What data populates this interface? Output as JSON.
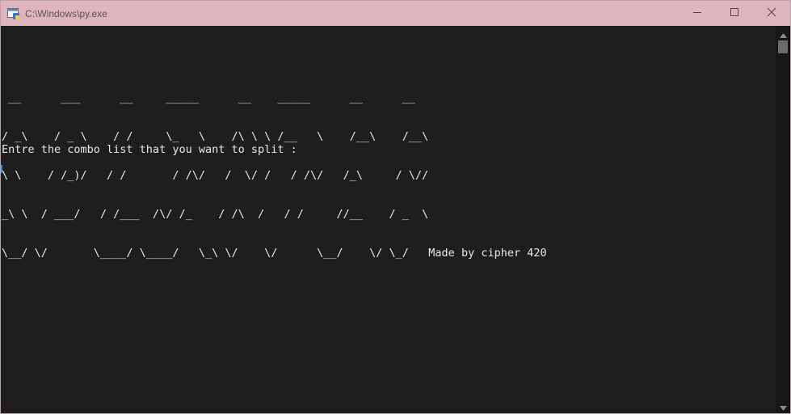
{
  "window": {
    "title": "C:\\Windows\\py.exe"
  },
  "controls": {
    "minimize": "minimize",
    "maximize": "maximize",
    "close": "close"
  },
  "console": {
    "banner_lines": [
      " __      ___      __     _____      __    _____      __      __",
      "/ _\\    / _ \\    / /     \\_   \\    /\\ \\ \\ /__   \\    /__\\    /__\\",
      "\\ \\    / /_)/   / /       / /\\/   /  \\/ /   / /\\/   /_\\     / \\//",
      "_\\ \\  / ___/   / /___  /\\/ /_    / /\\  /   / /     //__    / _  \\",
      "\\__/ \\/       \\____/ \\____/   \\_\\ \\/    \\/      \\__/    \\/ \\_/   Made by cipher 420"
    ],
    "prompt": "Entre the combo list that you want to split :"
  },
  "colors": {
    "titlebar": "#e0b4bd",
    "console_bg": "#1e1e1e",
    "console_text": "#e8e8e8"
  },
  "icons": {
    "app": "python-console-icon",
    "minimize": "minimize-icon",
    "maximize": "maximize-icon",
    "close": "close-icon"
  }
}
